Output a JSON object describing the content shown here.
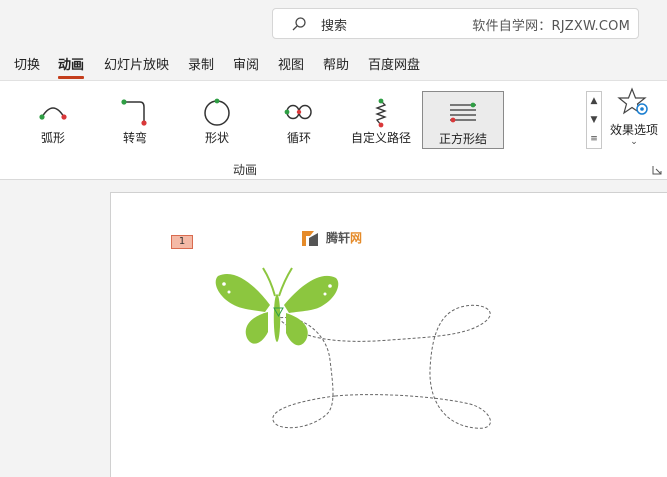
{
  "search": {
    "placeholder": "搜索",
    "watermark": "软件自学网：RJZXW.COM"
  },
  "tabs": [
    {
      "label": "切换"
    },
    {
      "label": "动画"
    },
    {
      "label": "幻灯片放映"
    },
    {
      "label": "录制"
    },
    {
      "label": "审阅"
    },
    {
      "label": "视图"
    },
    {
      "label": "帮助"
    },
    {
      "label": "百度网盘"
    }
  ],
  "active_tab": "动画",
  "ribbon": {
    "gallery": [
      {
        "label": "弧形",
        "icon": "arc-path-icon"
      },
      {
        "label": "转弯",
        "icon": "turn-path-icon"
      },
      {
        "label": "形状",
        "icon": "shape-path-icon"
      },
      {
        "label": "循环",
        "icon": "loop-path-icon"
      },
      {
        "label": "自定义路径",
        "icon": "custom-path-icon"
      },
      {
        "label": "正方形结",
        "icon": "square-knot-icon"
      }
    ],
    "selected": "正方形结",
    "effects_label": "效果选项",
    "group_name": "动画"
  },
  "slide": {
    "animation_number": "1",
    "logo": {
      "part1": "腾轩",
      "part2": "网"
    },
    "path_start_color": "#2f9e44",
    "path_end_color": "#d9383a",
    "butterfly_color": "#8cc63f"
  }
}
